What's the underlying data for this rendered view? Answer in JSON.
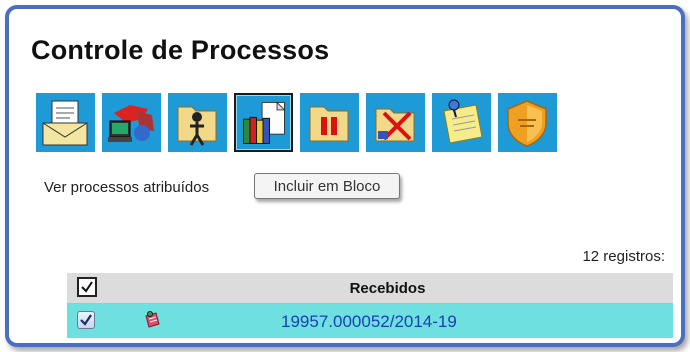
{
  "page": {
    "title": "Controle de Processos"
  },
  "toolbar": {
    "buttons": [
      {
        "icon": "envelope-document-icon",
        "selected": false
      },
      {
        "icon": "computer-network-icon",
        "selected": false
      },
      {
        "icon": "folder-person-icon",
        "selected": false
      },
      {
        "icon": "books-document-icon",
        "selected": true
      },
      {
        "icon": "folder-pause-icon",
        "selected": false
      },
      {
        "icon": "folder-cancel-icon",
        "selected": false
      },
      {
        "icon": "sticky-note-pin-icon",
        "selected": false
      },
      {
        "icon": "shield-icon",
        "selected": false
      }
    ]
  },
  "filter": {
    "label": "Ver processos atribuídos"
  },
  "tooltip": {
    "text": "Incluir em Bloco"
  },
  "table": {
    "count": "12 registros:",
    "header": "Recebidos",
    "rows": [
      {
        "process": "19957.000052/2014-19",
        "checked": true,
        "highlight_color": "#6fe0e0"
      }
    ]
  },
  "colors": {
    "accent": "#1e9bd7",
    "frame": "#4a6fc0",
    "link": "#1a3fb5"
  }
}
